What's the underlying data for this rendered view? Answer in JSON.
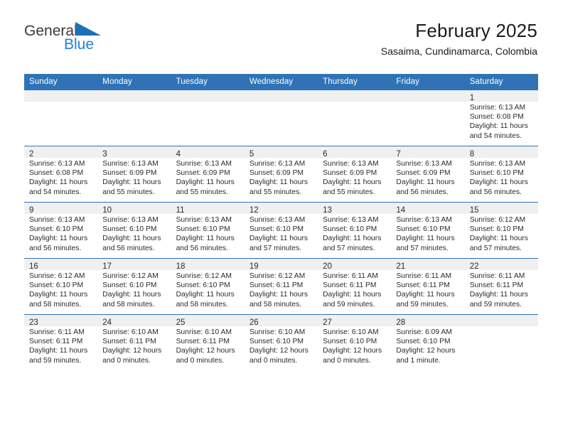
{
  "brand": {
    "name_top": "General",
    "name_bottom": "Blue",
    "triangle_icon": "blue-triangle-icon",
    "color_blue": "#1f7fd4",
    "color_dark": "#3a3a3a"
  },
  "header": {
    "title": "February 2025",
    "subtitle": "Sasaima, Cundinamarca, Colombia"
  },
  "theme": {
    "header_blue": "#2f73b6",
    "band_gray": "#f0f0f0",
    "text": "#2b2b2b"
  },
  "weekday_headers": [
    "Sunday",
    "Monday",
    "Tuesday",
    "Wednesday",
    "Thursday",
    "Friday",
    "Saturday"
  ],
  "weeks": [
    [
      {
        "day": "",
        "lines": []
      },
      {
        "day": "",
        "lines": []
      },
      {
        "day": "",
        "lines": []
      },
      {
        "day": "",
        "lines": []
      },
      {
        "day": "",
        "lines": []
      },
      {
        "day": "",
        "lines": []
      },
      {
        "day": "1",
        "lines": [
          "Sunrise: 6:13 AM",
          "Sunset: 6:08 PM",
          "Daylight: 11 hours",
          "and 54 minutes."
        ]
      }
    ],
    [
      {
        "day": "2",
        "lines": [
          "Sunrise: 6:13 AM",
          "Sunset: 6:08 PM",
          "Daylight: 11 hours",
          "and 54 minutes."
        ]
      },
      {
        "day": "3",
        "lines": [
          "Sunrise: 6:13 AM",
          "Sunset: 6:09 PM",
          "Daylight: 11 hours",
          "and 55 minutes."
        ]
      },
      {
        "day": "4",
        "lines": [
          "Sunrise: 6:13 AM",
          "Sunset: 6:09 PM",
          "Daylight: 11 hours",
          "and 55 minutes."
        ]
      },
      {
        "day": "5",
        "lines": [
          "Sunrise: 6:13 AM",
          "Sunset: 6:09 PM",
          "Daylight: 11 hours",
          "and 55 minutes."
        ]
      },
      {
        "day": "6",
        "lines": [
          "Sunrise: 6:13 AM",
          "Sunset: 6:09 PM",
          "Daylight: 11 hours",
          "and 55 minutes."
        ]
      },
      {
        "day": "7",
        "lines": [
          "Sunrise: 6:13 AM",
          "Sunset: 6:09 PM",
          "Daylight: 11 hours",
          "and 56 minutes."
        ]
      },
      {
        "day": "8",
        "lines": [
          "Sunrise: 6:13 AM",
          "Sunset: 6:10 PM",
          "Daylight: 11 hours",
          "and 56 minutes."
        ]
      }
    ],
    [
      {
        "day": "9",
        "lines": [
          "Sunrise: 6:13 AM",
          "Sunset: 6:10 PM",
          "Daylight: 11 hours",
          "and 56 minutes."
        ]
      },
      {
        "day": "10",
        "lines": [
          "Sunrise: 6:13 AM",
          "Sunset: 6:10 PM",
          "Daylight: 11 hours",
          "and 56 minutes."
        ]
      },
      {
        "day": "11",
        "lines": [
          "Sunrise: 6:13 AM",
          "Sunset: 6:10 PM",
          "Daylight: 11 hours",
          "and 56 minutes."
        ]
      },
      {
        "day": "12",
        "lines": [
          "Sunrise: 6:13 AM",
          "Sunset: 6:10 PM",
          "Daylight: 11 hours",
          "and 57 minutes."
        ]
      },
      {
        "day": "13",
        "lines": [
          "Sunrise: 6:13 AM",
          "Sunset: 6:10 PM",
          "Daylight: 11 hours",
          "and 57 minutes."
        ]
      },
      {
        "day": "14",
        "lines": [
          "Sunrise: 6:13 AM",
          "Sunset: 6:10 PM",
          "Daylight: 11 hours",
          "and 57 minutes."
        ]
      },
      {
        "day": "15",
        "lines": [
          "Sunrise: 6:12 AM",
          "Sunset: 6:10 PM",
          "Daylight: 11 hours",
          "and 57 minutes."
        ]
      }
    ],
    [
      {
        "day": "16",
        "lines": [
          "Sunrise: 6:12 AM",
          "Sunset: 6:10 PM",
          "Daylight: 11 hours",
          "and 58 minutes."
        ]
      },
      {
        "day": "17",
        "lines": [
          "Sunrise: 6:12 AM",
          "Sunset: 6:10 PM",
          "Daylight: 11 hours",
          "and 58 minutes."
        ]
      },
      {
        "day": "18",
        "lines": [
          "Sunrise: 6:12 AM",
          "Sunset: 6:10 PM",
          "Daylight: 11 hours",
          "and 58 minutes."
        ]
      },
      {
        "day": "19",
        "lines": [
          "Sunrise: 6:12 AM",
          "Sunset: 6:11 PM",
          "Daylight: 11 hours",
          "and 58 minutes."
        ]
      },
      {
        "day": "20",
        "lines": [
          "Sunrise: 6:11 AM",
          "Sunset: 6:11 PM",
          "Daylight: 11 hours",
          "and 59 minutes."
        ]
      },
      {
        "day": "21",
        "lines": [
          "Sunrise: 6:11 AM",
          "Sunset: 6:11 PM",
          "Daylight: 11 hours",
          "and 59 minutes."
        ]
      },
      {
        "day": "22",
        "lines": [
          "Sunrise: 6:11 AM",
          "Sunset: 6:11 PM",
          "Daylight: 11 hours",
          "and 59 minutes."
        ]
      }
    ],
    [
      {
        "day": "23",
        "lines": [
          "Sunrise: 6:11 AM",
          "Sunset: 6:11 PM",
          "Daylight: 11 hours",
          "and 59 minutes."
        ]
      },
      {
        "day": "24",
        "lines": [
          "Sunrise: 6:10 AM",
          "Sunset: 6:11 PM",
          "Daylight: 12 hours",
          "and 0 minutes."
        ]
      },
      {
        "day": "25",
        "lines": [
          "Sunrise: 6:10 AM",
          "Sunset: 6:11 PM",
          "Daylight: 12 hours",
          "and 0 minutes."
        ]
      },
      {
        "day": "26",
        "lines": [
          "Sunrise: 6:10 AM",
          "Sunset: 6:10 PM",
          "Daylight: 12 hours",
          "and 0 minutes."
        ]
      },
      {
        "day": "27",
        "lines": [
          "Sunrise: 6:10 AM",
          "Sunset: 6:10 PM",
          "Daylight: 12 hours",
          "and 0 minutes."
        ]
      },
      {
        "day": "28",
        "lines": [
          "Sunrise: 6:09 AM",
          "Sunset: 6:10 PM",
          "Daylight: 12 hours",
          "and 1 minute."
        ]
      },
      {
        "day": "",
        "lines": []
      }
    ]
  ]
}
